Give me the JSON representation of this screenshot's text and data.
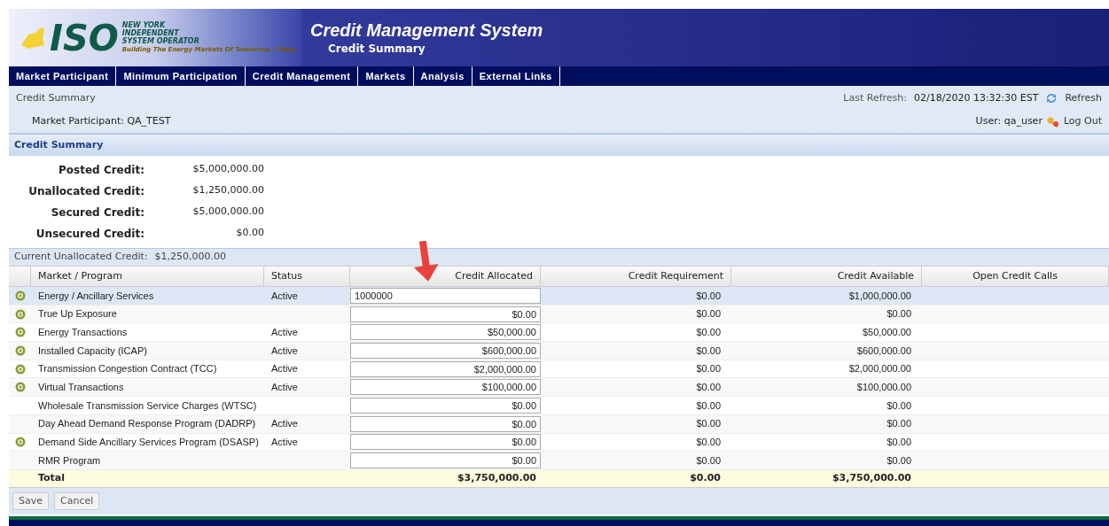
{
  "logo": {
    "mark": "ISO",
    "org_lines": [
      "NEW YORK",
      "INDEPENDENT",
      "SYSTEM OPERATOR"
    ],
    "tagline": "Building The Energy Markets Of Tomorrow...Today"
  },
  "header": {
    "title": "Credit Management System",
    "subtitle": "Credit Summary"
  },
  "nav": [
    {
      "label": "Market Participant"
    },
    {
      "label": "Minimum Participation"
    },
    {
      "label": "Credit Management"
    },
    {
      "label": "Markets"
    },
    {
      "label": "Analysis"
    },
    {
      "label": "External Links"
    }
  ],
  "breadcrumb": "Credit Summary",
  "last_refresh": {
    "label": "Last Refresh:",
    "value": "02/18/2020 13:32:30 EST",
    "action": "Refresh"
  },
  "participant": {
    "label": "Market Participant:",
    "value": "QA_TEST"
  },
  "user": {
    "label": "User:",
    "value": "qa_user",
    "action": "Log Out"
  },
  "summary": {
    "title": "Credit Summary",
    "items": [
      {
        "label": "Posted Credit:",
        "value": "$5,000,000.00"
      },
      {
        "label": "Unallocated Credit:",
        "value": "$1,250,000.00"
      },
      {
        "label": "Secured Credit:",
        "value": "$5,000,000.00"
      },
      {
        "label": "Unsecured Credit:",
        "value": "$0.00"
      }
    ]
  },
  "current_unallocated": {
    "label": "Current Unallocated Credit:",
    "value": "$1,250,000.00"
  },
  "table": {
    "columns": [
      "Market / Program",
      "Status",
      "Credit Allocated",
      "Credit Requirement",
      "Credit Available",
      "Open Credit Calls"
    ],
    "rows": [
      {
        "has_icon": true,
        "selected": true,
        "program": "Energy / Ancillary Services",
        "status": "Active",
        "allocated": "1000000",
        "requirement": "$0.00",
        "available": "$1,000,000.00"
      },
      {
        "has_icon": true,
        "selected": false,
        "program": "True Up Exposure",
        "status": "",
        "allocated": "$0.00",
        "requirement": "$0.00",
        "available": "$0.00"
      },
      {
        "has_icon": true,
        "selected": false,
        "program": "Energy Transactions",
        "status": "Active",
        "allocated": "$50,000.00",
        "requirement": "$0.00",
        "available": "$50,000.00"
      },
      {
        "has_icon": true,
        "selected": false,
        "program": "Installed Capacity (ICAP)",
        "status": "Active",
        "allocated": "$600,000.00",
        "requirement": "$0.00",
        "available": "$600,000.00"
      },
      {
        "has_icon": true,
        "selected": false,
        "program": "Transmission Congestion Contract (TCC)",
        "status": "Active",
        "allocated": "$2,000,000.00",
        "requirement": "$0.00",
        "available": "$2,000,000.00"
      },
      {
        "has_icon": true,
        "selected": false,
        "program": "Virtual Transactions",
        "status": "Active",
        "allocated": "$100,000.00",
        "requirement": "$0.00",
        "available": "$100,000.00"
      },
      {
        "has_icon": false,
        "selected": false,
        "program": "Wholesale Transmission Service Charges (WTSC)",
        "status": "",
        "allocated": "$0.00",
        "requirement": "$0.00",
        "available": "$0.00"
      },
      {
        "has_icon": false,
        "selected": false,
        "program": "Day Ahead Demand Response Program (DADRP)",
        "status": "Active",
        "allocated": "$0.00",
        "requirement": "$0.00",
        "available": "$0.00"
      },
      {
        "has_icon": true,
        "selected": false,
        "program": "Demand Side Ancillary Services Program (DSASP)",
        "status": "Active",
        "allocated": "$0.00",
        "requirement": "$0.00",
        "available": "$0.00"
      },
      {
        "has_icon": false,
        "selected": false,
        "program": "RMR Program",
        "status": "",
        "allocated": "$0.00",
        "requirement": "$0.00",
        "available": "$0.00"
      }
    ],
    "total": {
      "label": "Total",
      "allocated": "$3,750,000.00",
      "requirement": "$0.00",
      "available": "$3,750,000.00"
    }
  },
  "buttons": [
    "Save",
    "Cancel"
  ]
}
